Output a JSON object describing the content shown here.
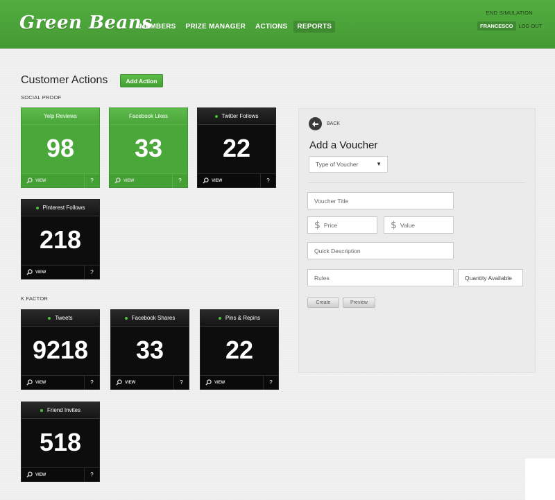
{
  "header": {
    "logo": "Green Beans",
    "nav": [
      {
        "label": "MEMBERS",
        "active": false
      },
      {
        "label": "PRIZE MANAGER",
        "active": false
      },
      {
        "label": "ACTIONS",
        "active": false
      },
      {
        "label": "REPORTS",
        "active": true
      }
    ],
    "end_simulation": "END SIMULATION",
    "user_name": "FRANCESCO",
    "logout": "LOG OUT"
  },
  "main": {
    "title": "Customer Actions",
    "add_action": "Add Action",
    "sections": {
      "social_proof": "SOCIAL PROOF",
      "k_factor": "K FACTOR"
    },
    "tiles": [
      {
        "label": "Yelp Reviews",
        "value": "98",
        "style": "green",
        "view": "VIEW",
        "help": "?"
      },
      {
        "label": "Facebook Likes",
        "value": "33",
        "style": "green",
        "view": "VIEW",
        "help": "?"
      },
      {
        "label": "Twitter Follows",
        "value": "22",
        "style": "black",
        "view": "VIEW",
        "help": "?"
      },
      {
        "label": "Pinterest Follows",
        "value": "218",
        "style": "black",
        "view": "VIEW",
        "help": "?"
      },
      {
        "label": "Tweets",
        "value": "9218",
        "style": "black",
        "view": "VIEW",
        "help": "?"
      },
      {
        "label": "Facebook Shares",
        "value": "33",
        "style": "black",
        "view": "VIEW",
        "help": "?"
      },
      {
        "label": "Pins & Repins",
        "value": "22",
        "style": "black",
        "view": "VIEW",
        "help": "?"
      },
      {
        "label": "Friend Invites",
        "value": "518",
        "style": "black",
        "view": "VIEW",
        "help": "?"
      }
    ]
  },
  "voucher_panel": {
    "back": "BACK",
    "title": "Add a Voucher",
    "type_select": "Type of Voucher",
    "voucher_title_placeholder": "Voucher Title",
    "price_placeholder": "Price",
    "value_placeholder": "Value",
    "description_placeholder": "Quick Description",
    "rules_placeholder": "Rules",
    "quantity_placeholder": "Quantity Available",
    "currency_symbol": "$",
    "create": "Create",
    "preview": "Preview"
  },
  "colors": {
    "brand_green": "#4aa73a",
    "tile_dark": "#0d0d0d",
    "status_dot": "#4cc03a"
  }
}
